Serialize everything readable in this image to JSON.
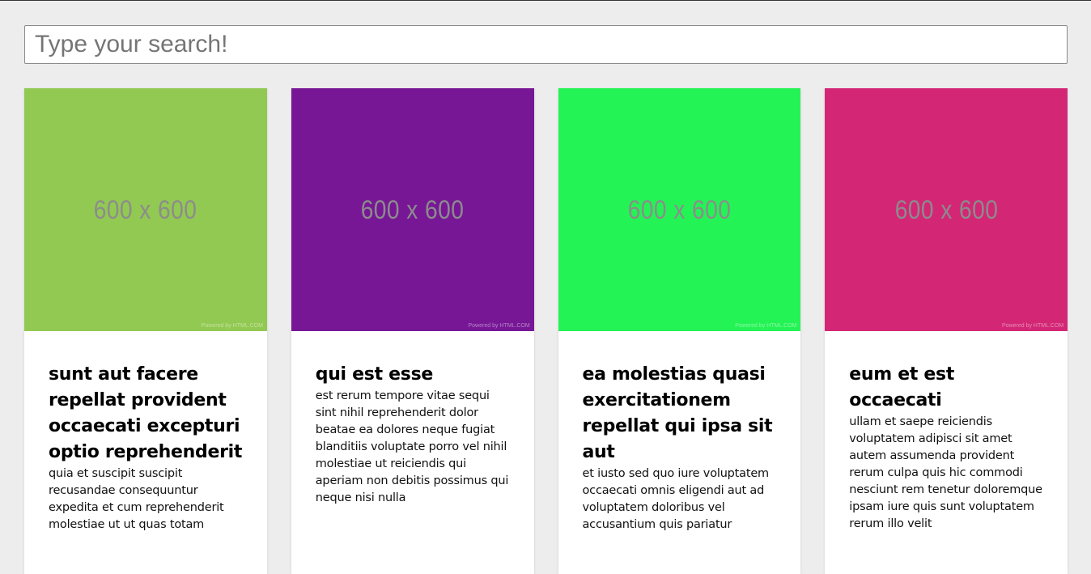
{
  "search": {
    "placeholder": "Type your search!",
    "value": ""
  },
  "cards": [
    {
      "image_label": "600 x 600",
      "image_credit": "Powered by HTML.COM",
      "image_color": "#92c952",
      "title": "sunt aut facere repellat provident occaecati excepturi optio reprehenderit",
      "body": "quia et suscipit suscipit recusandae consequuntur expedita et cum reprehenderit molestiae ut ut quas totam"
    },
    {
      "image_label": "600 x 600",
      "image_credit": "Powered by HTML.COM",
      "image_color": "#771796",
      "title": "qui est esse",
      "body": "est rerum tempore vitae sequi sint nihil reprehenderit dolor beatae ea dolores neque fugiat blanditiis voluptate porro vel nihil molestiae ut reiciendis qui aperiam non debitis possimus qui neque nisi nulla"
    },
    {
      "image_label": "600 x 600",
      "image_credit": "Powered by HTML.COM",
      "image_color": "#24f355",
      "title": "ea molestias quasi exercitationem repellat qui ipsa sit aut",
      "body": "et iusto sed quo iure voluptatem occaecati omnis eligendi aut ad voluptatem doloribus vel accusantium quis pariatur"
    },
    {
      "image_label": "600 x 600",
      "image_credit": "Powered by HTML.COM",
      "image_color": "#d32776",
      "title": "eum et est occaecati",
      "body": "ullam et saepe reiciendis voluptatem adipisci sit amet autem assumenda provident rerum culpa quis hic commodi nesciunt rem tenetur doloremque ipsam iure quis sunt voluptatem rerum illo velit"
    }
  ]
}
